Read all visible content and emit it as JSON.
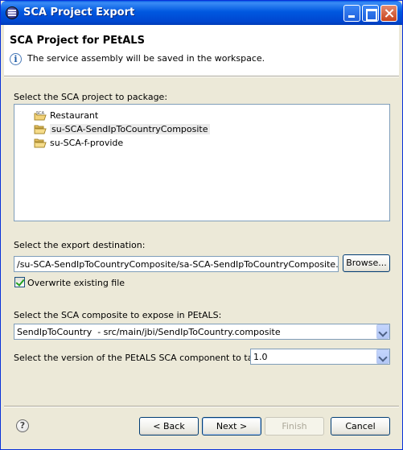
{
  "window": {
    "title": "SCA Project Export"
  },
  "banner": {
    "title": "SCA Project for PEtALS",
    "message": "The service assembly will be saved in the workspace."
  },
  "project_section": {
    "label": "Select the SCA project to package:",
    "items": [
      {
        "label": "Restaurant",
        "icon": "sca-project-icon",
        "selected": false
      },
      {
        "label": "su-SCA-SendIpToCountryComposite",
        "icon": "folder-icon",
        "selected": true
      },
      {
        "label": "su-SCA-f-provide",
        "icon": "folder-icon",
        "selected": false
      }
    ]
  },
  "export_section": {
    "label": "Select the export destination:",
    "path": "/su-SCA-SendIpToCountryComposite/sa-SCA-SendIpToCountryComposite.zip",
    "browse_label": "Browse...",
    "overwrite_label": "Overwrite existing file",
    "overwrite_checked": true
  },
  "composite_section": {
    "label": "Select the SCA composite to expose in PEtALS:",
    "selected": "SendIpToCountry  - src/main/jbi/SendIpToCountry.composite"
  },
  "version_section": {
    "label": "Select the version of the PEtALS SCA component to target:",
    "selected": "1.0"
  },
  "buttons": {
    "back": "< Back",
    "next": "Next >",
    "finish": "Finish",
    "cancel": "Cancel"
  },
  "icons": {
    "help": "?",
    "info": "i",
    "sca_badge": "SCA"
  }
}
